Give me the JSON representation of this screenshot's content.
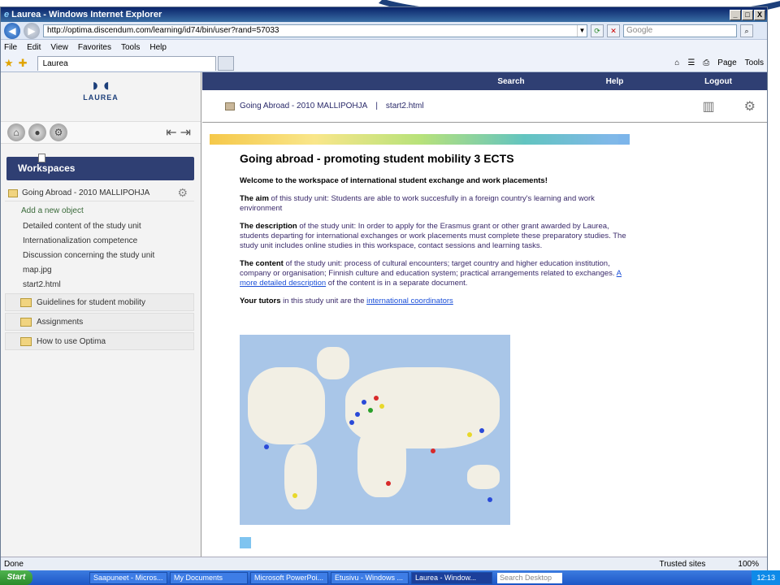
{
  "window": {
    "title": "Laurea - Windows Internet Explorer",
    "minimize": "_",
    "maximize": "□",
    "close": "X"
  },
  "address_bar": {
    "url": "http://optima.discendum.com/learning/id74/bin/user?rand=57033",
    "search_placeholder": "Google"
  },
  "menu": [
    "File",
    "Edit",
    "View",
    "Favorites",
    "Tools",
    "Help"
  ],
  "tab": {
    "label": "Laurea"
  },
  "commands": {
    "page": "Page",
    "tools": "Tools"
  },
  "logo": {
    "word": "LAUREA"
  },
  "sidebar": {
    "workspaces_header": "Workspaces",
    "workspace_name": "Going Abroad - 2010 MALLIPOHJA",
    "add_new": "Add a new object",
    "items": [
      {
        "label": "Detailed content of the study unit"
      },
      {
        "label": "Internationalization competence"
      },
      {
        "label": "Discussion concerning the study unit"
      },
      {
        "label": "map.jpg"
      },
      {
        "label": "start2.html"
      }
    ],
    "folders": [
      {
        "label": "Guidelines for student mobility"
      },
      {
        "label": "Assignments"
      },
      {
        "label": "How to use Optima"
      }
    ]
  },
  "topnav": {
    "search": "Search",
    "help": "Help",
    "logout": "Logout"
  },
  "breadcrumb": {
    "workspace": "Going Abroad - 2010 MALLIPOHJA",
    "separator": "|",
    "page": "start2.html"
  },
  "document": {
    "title": "Going abroad - promoting student mobility 3 ECTS",
    "welcome": "Welcome to the workspace of international student exchange and work placements!",
    "aim_label": "The aim",
    "aim_text": " of this study unit: Students are able to work succesfully in a foreign country's learning and work environment",
    "desc_label": "The description",
    "desc_text": " of the study unit: In order to apply for the Erasmus grant or other grant awarded by Laurea, students departing for international exchanges or work placements must complete these preparatory studies. The study unit includes online studies in this workspace, contact sessions and learning tasks.",
    "content_label": "The content",
    "content_text": " of the study unit: process of cultural encounters; target country and higher education institution, company or organisation; Finnish culture and education system; practical arrangements related to exchanges.",
    "more_link": "A more detailed description",
    "more_text": " of the content is in a separate document.",
    "tutors_label": "Your tutors",
    "tutors_text": " in this study unit are the ",
    "tutors_link": "international coordinators"
  },
  "status": {
    "left": "Done",
    "zone": "Trusted sites",
    "zoom": "100%"
  },
  "taskbar": {
    "start": "Start",
    "items": [
      "Saapuneet - Micros...",
      "My Documents",
      "Microsoft PowerPoi...",
      "Etusivu - Windows ...",
      "Laurea - Window..."
    ],
    "search_placeholder": "Search Desktop",
    "clock": "12:13"
  }
}
